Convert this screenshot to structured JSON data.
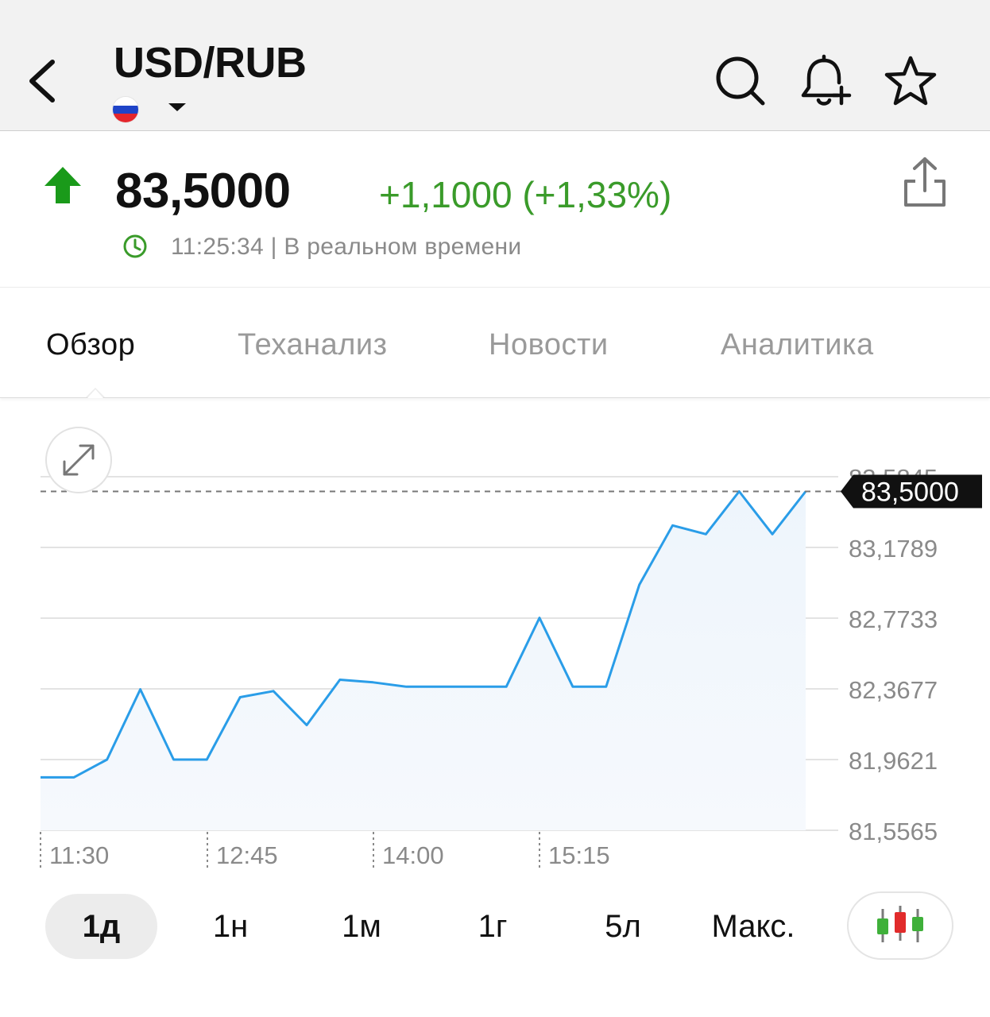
{
  "header": {
    "title": "USD/RUB",
    "flag_colors": [
      "#ffffff",
      "#1f44c8",
      "#e4262c"
    ]
  },
  "quote": {
    "price": "83,5000",
    "change": "+1,1000 (+1,33%)",
    "time": "11:25:34 | В реальном времени",
    "up_color": "#1a9a1a",
    "change_color": "#3a9b2a"
  },
  "tabs": [
    {
      "label": "Обзор",
      "active": true
    },
    {
      "label": "Теханализ",
      "active": false
    },
    {
      "label": "Новости",
      "active": false
    },
    {
      "label": "Аналитика",
      "active": false
    }
  ],
  "periods": [
    {
      "label": "1д",
      "active": true
    },
    {
      "label": "1н",
      "active": false
    },
    {
      "label": "1м",
      "active": false
    },
    {
      "label": "1г",
      "active": false
    },
    {
      "label": "5л",
      "active": false
    },
    {
      "label": "Макс.",
      "active": false
    }
  ],
  "chart_data": {
    "type": "area",
    "x_ticks": [
      "11:30",
      "12:45",
      "14:00",
      "15:15"
    ],
    "y_ticks": [
      "83,5845",
      "83,1789",
      "82,7733",
      "82,3677",
      "81,9621",
      "81,5565"
    ],
    "y_tick_values": [
      83.5845,
      83.1789,
      82.7733,
      82.3677,
      81.9621,
      81.5565
    ],
    "ylim": [
      81.5565,
      83.5845
    ],
    "current_label": "83,5000",
    "current_value": 83.5,
    "line_color": "#2a9de8",
    "values": [
      81.86,
      81.86,
      81.962,
      82.365,
      81.962,
      81.962,
      82.32,
      82.355,
      82.16,
      82.42,
      82.405,
      82.38,
      82.38,
      82.38,
      82.38,
      82.775,
      82.38,
      82.38,
      82.965,
      83.305,
      83.255,
      83.5,
      83.255,
      83.5
    ]
  }
}
